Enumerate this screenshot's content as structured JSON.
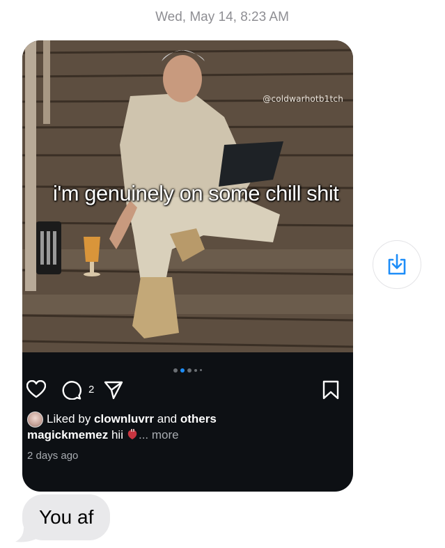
{
  "timestamp": "Wed, May 14, 8:23 AM",
  "post": {
    "watermark": "@coldwarhotb1tch",
    "overlay_caption": "i'm genuinely on some chill shit",
    "carousel": {
      "count": 5,
      "active_index": 1
    },
    "comment_count": "2",
    "liked_by_prefix": "Liked by ",
    "liked_by_user": "clownluvrr",
    "liked_by_and": " and ",
    "liked_by_others": "others",
    "author": "magickmemez",
    "caption_text": " hii",
    "more_label": "... more",
    "time_ago": "2 days ago"
  },
  "message": {
    "text": "You af"
  },
  "icons": {
    "like": "heart-icon",
    "comment": "comment-icon",
    "share": "send-icon",
    "save": "bookmark-icon",
    "download": "download-share-icon"
  },
  "colors": {
    "card_bg": "#0d1014",
    "accent": "#1d8df8",
    "bubble_bg": "#e9e9eb",
    "timestamp": "#8e8e93"
  }
}
